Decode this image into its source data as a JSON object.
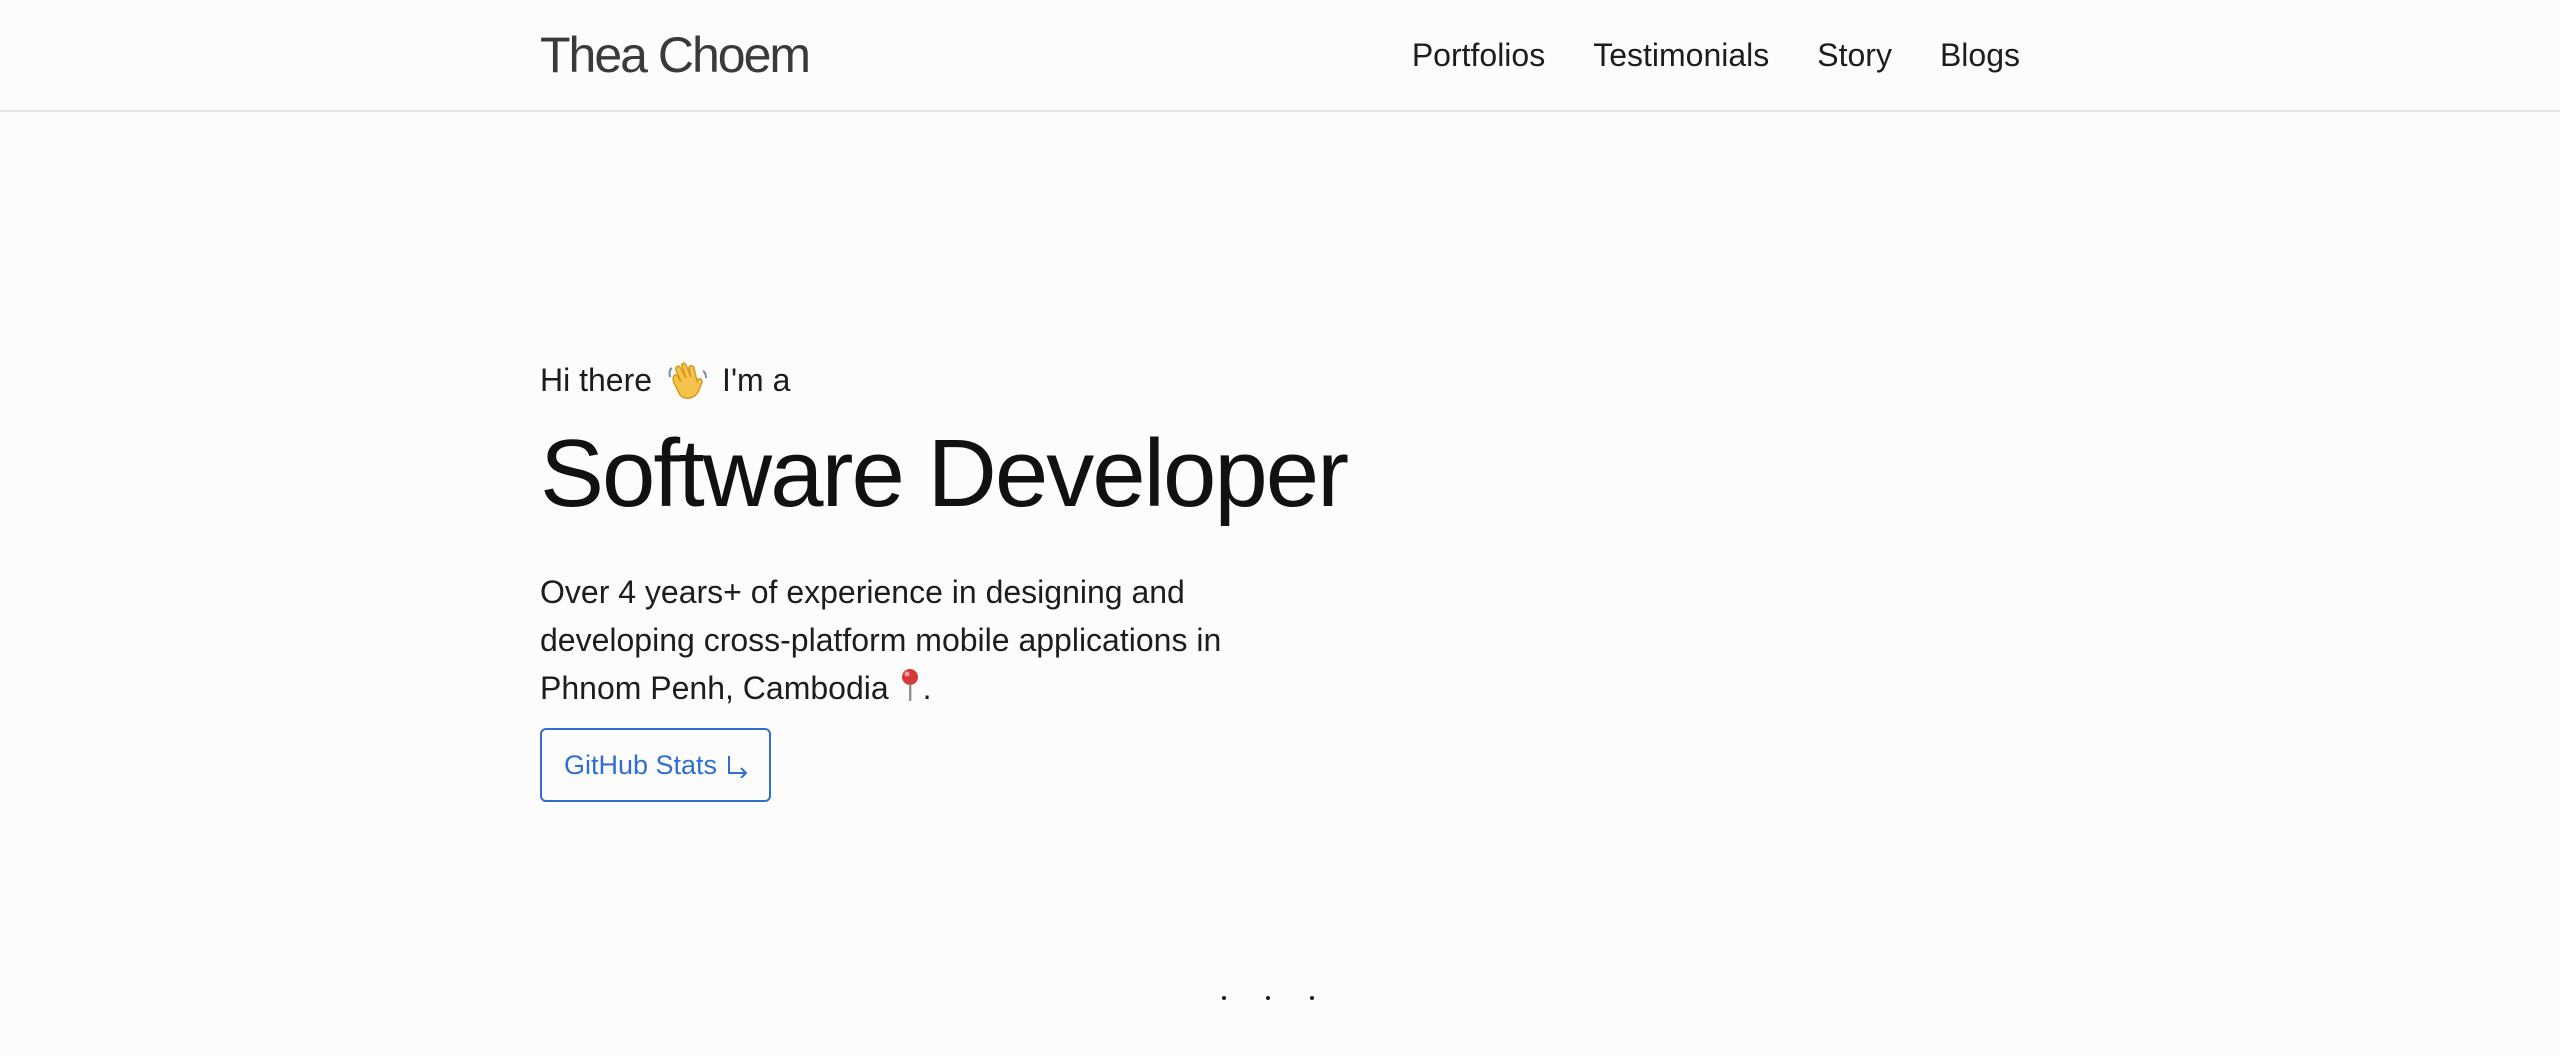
{
  "header": {
    "brand": "Thea Choem",
    "nav": [
      {
        "label": "Portfolios"
      },
      {
        "label": "Testimonials"
      },
      {
        "label": "Story"
      },
      {
        "label": "Blogs"
      }
    ]
  },
  "hero": {
    "greeting_start": "Hi there",
    "greeting_end": "I'm a",
    "wave_icon": "waving-hand-icon",
    "title": "Software Developer",
    "description": "Over 4 years+ of experience in designing and developing cross-platform mobile applications in Phnom Penh, Cambodia",
    "description_end": ".",
    "pin_icon": "round-pushpin-icon",
    "button_label": "GitHub Stats",
    "button_icon": "arrow-down-right-icon",
    "accent_color": "#2f6fd0"
  },
  "indicator": {
    "dot_count": 3
  }
}
